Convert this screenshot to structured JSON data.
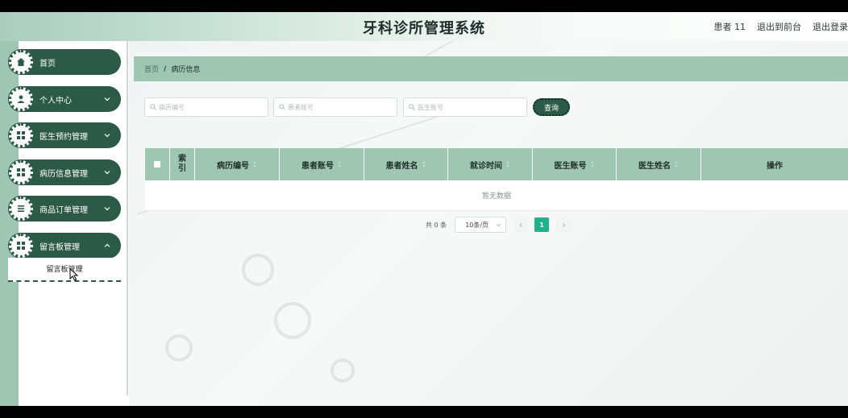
{
  "header": {
    "title": "牙科诊所管理系统",
    "user_label": "患者 11",
    "back_to_front": "退出到前台",
    "logout": "退出登录"
  },
  "sidebar": {
    "items": [
      {
        "label": "首页",
        "icon": "home-icon",
        "has_chevron": false
      },
      {
        "label": "个人中心",
        "icon": "person-icon",
        "has_chevron": true
      },
      {
        "label": "医生预约管理",
        "icon": "grid-icon",
        "has_chevron": true
      },
      {
        "label": "病历信息管理",
        "icon": "grid-icon",
        "has_chevron": true
      },
      {
        "label": "商品订单管理",
        "icon": "list-icon",
        "has_chevron": true
      },
      {
        "label": "留言板管理",
        "icon": "grid-icon",
        "has_chevron": true
      }
    ],
    "submenu": {
      "label": "留言板管理"
    }
  },
  "breadcrumb": {
    "home": "首页",
    "separator": "/",
    "current": "病历信息"
  },
  "search": {
    "record_no_placeholder": "病历编号",
    "patient_account_placeholder": "患者账号",
    "doctor_account_placeholder": "医生账号",
    "query_button": "查询"
  },
  "table": {
    "columns": [
      "索引",
      "病历编号",
      "患者账号",
      "患者姓名",
      "就诊时间",
      "医生账号",
      "医生姓名",
      "操作"
    ],
    "empty_text": "暂无数据"
  },
  "pagination": {
    "total_text": "共 0 条",
    "page_size": "10条/页",
    "current_page": "1"
  },
  "colors": {
    "primary": "#2c5a48",
    "accent": "#9ec6b3",
    "page_active": "#1fb38a"
  }
}
